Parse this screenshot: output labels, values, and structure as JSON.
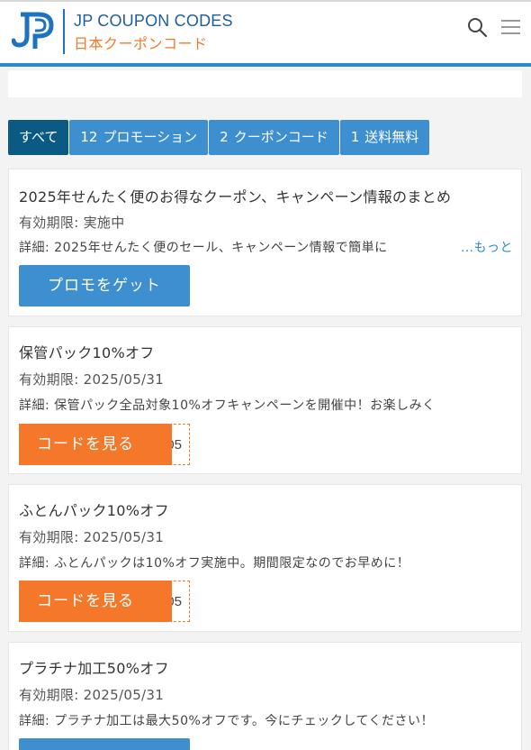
{
  "header": {
    "logo_letters": "JP",
    "brand_en": "JP COUPON CODES",
    "brand_jp": "日本クーポンコード",
    "colors": {
      "brand_blue": "#1e5f9a",
      "brand_orange": "#f07b2a",
      "accent_bar": "#2b8ac9"
    },
    "icons": {
      "search": "search-icon",
      "menu": "hamburger-menu-icon"
    }
  },
  "tabs": [
    {
      "count": "",
      "label": "すべて",
      "active": true
    },
    {
      "count": "12",
      "label": "プロモーション",
      "active": false
    },
    {
      "count": "2",
      "label": "クーポンコード",
      "active": false
    },
    {
      "count": "1",
      "label": "送料無料",
      "active": false
    }
  ],
  "offers": [
    {
      "title": "2025年せんたく便のお得なクーポン、キャンペーン情報のまとめ",
      "expiry": "有効期限: 実施中",
      "detail": "詳細: 2025年せんたく便のセール、キャンペーン情報で簡単に",
      "more": "…もっと",
      "action": "プロモをゲット"
    },
    {
      "title": "保管パック10%オフ",
      "expiry": "有効期限: 2025/05/31",
      "detail": "詳細: 保管パック全品対象10%オフキャンペーンを開催中！お楽しみく",
      "action": "コードを見る",
      "code_peek": "505"
    },
    {
      "title": "ふとんパック10%オフ",
      "expiry": "有効期限: 2025/05/31",
      "detail": "詳細: ふとんパックは10%オフ実施中。期間限定なのでお早めに！",
      "action": "コードを見る",
      "code_peek": "505"
    },
    {
      "title": "プラチナ加工50%オフ",
      "expiry": "有効期限: 2025/05/31",
      "detail": "詳細: プラチナ加工は最大50%オフです。今にチェックしてください！",
      "action": ""
    }
  ]
}
